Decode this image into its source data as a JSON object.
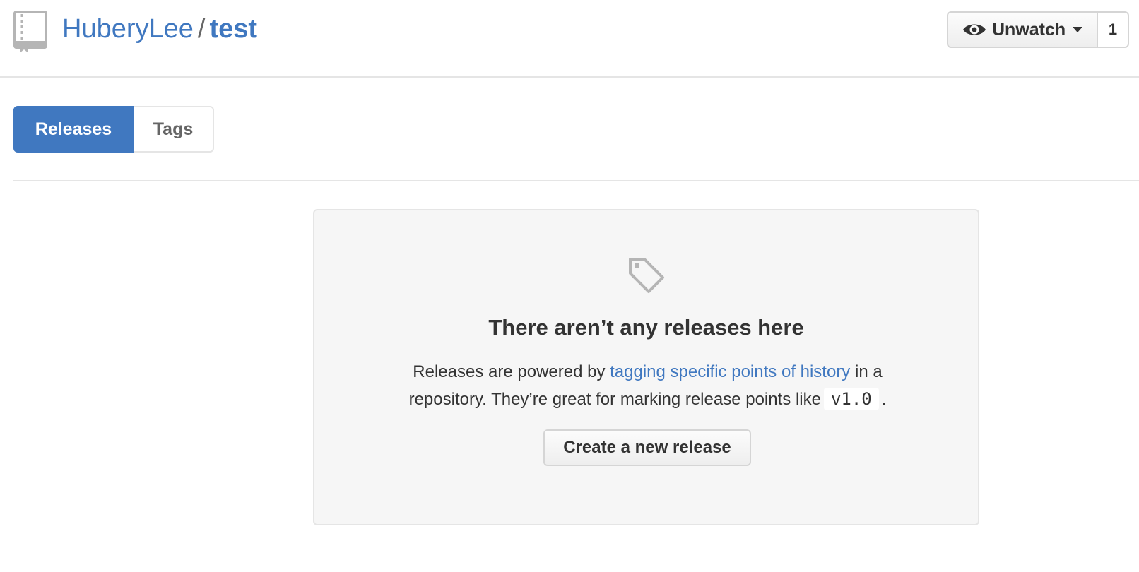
{
  "repo": {
    "owner": "HuberyLee",
    "separator": "/",
    "name": "test"
  },
  "watch": {
    "label": "Unwatch",
    "count": "1"
  },
  "tabs": [
    {
      "label": "Releases",
      "selected": true
    },
    {
      "label": "Tags",
      "selected": false
    }
  ],
  "blankslate": {
    "icon": "tag-icon",
    "title": "There aren’t any releases here",
    "text_before_link": "Releases are powered by ",
    "link_text": "tagging specific points of history",
    "text_after_link": " in a repository. They’re great for marking release points like",
    "code_example": "v1.0",
    "text_end": ".",
    "button_label": "Create a new release"
  },
  "colors": {
    "accent": "#4078c0",
    "text": "#333333",
    "muted": "#666666",
    "border": "#e5e5e5",
    "blankslate_bg": "#f6f6f6"
  },
  "icons": {
    "repo": "repo-book-icon",
    "watch": "eye-icon",
    "dropdown": "caret-down-icon",
    "empty_state": "tag-icon"
  }
}
